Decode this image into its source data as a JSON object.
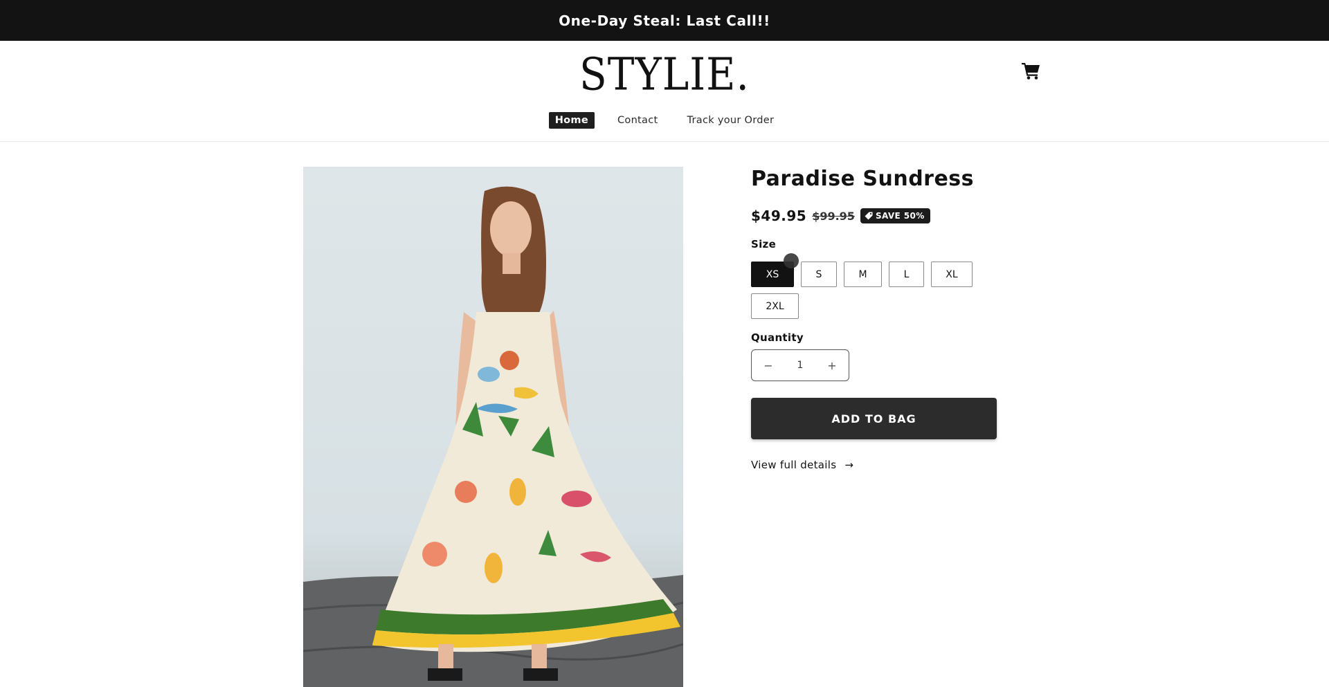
{
  "announcement": {
    "text": "One-Day Steal: Last Call!!"
  },
  "header": {
    "logo": "STYLIE.",
    "cart_icon": "cart-icon",
    "nav": [
      {
        "label": "Home",
        "active": true
      },
      {
        "label": "Contact",
        "active": false
      },
      {
        "label": "Track your Order",
        "active": false
      }
    ]
  },
  "product": {
    "image_alt": "Paradise Sundress model photo",
    "title": "Paradise Sundress",
    "price": "$49.95",
    "compare_price": "$99.95",
    "badge": "SAVE 50%",
    "badge_icon": "tag-icon",
    "size_label": "Size",
    "sizes": [
      "XS",
      "S",
      "M",
      "L",
      "XL",
      "2XL"
    ],
    "selected_size": "XS",
    "quantity_label": "Quantity",
    "quantity": "1",
    "decrement": "−",
    "increment": "+",
    "add_button": "ADD TO BAG",
    "details_link": "View full details",
    "details_arrow": "→"
  },
  "colors": {
    "accent": "#121212",
    "announcement_bg": "#131313",
    "button_bg": "#2c2c2c"
  }
}
